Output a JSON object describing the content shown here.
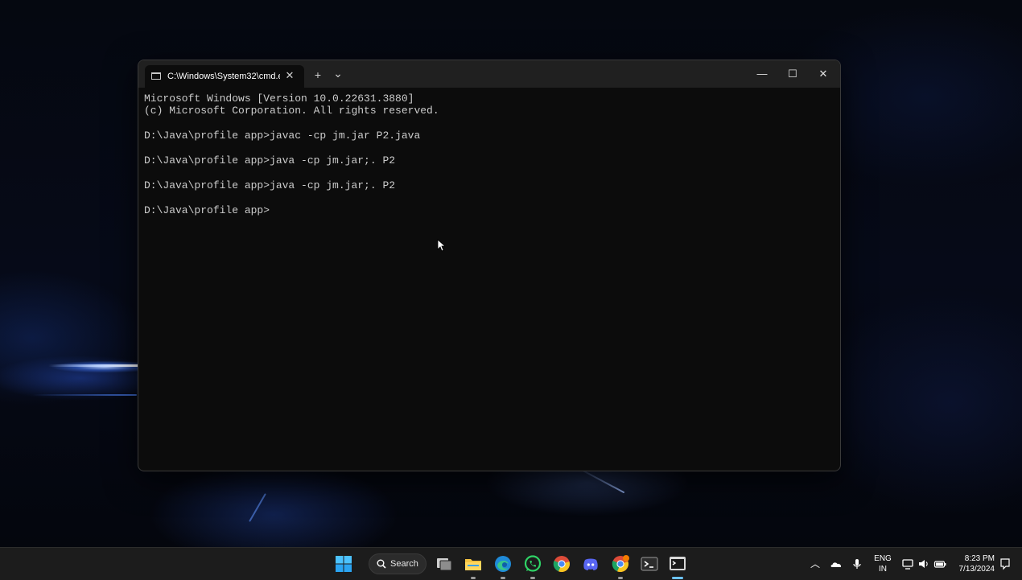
{
  "window": {
    "tab_title": "C:\\Windows\\System32\\cmd.e",
    "new_tab_symbol": "+",
    "dropdown_symbol": "⌄",
    "tab_close_symbol": "✕",
    "minimize_symbol": "—",
    "maximize_symbol": "☐",
    "close_symbol": "✕"
  },
  "console": {
    "lines": [
      "Microsoft Windows [Version 10.0.22631.3880]",
      "(c) Microsoft Corporation. All rights reserved.",
      "",
      "D:\\Java\\profile app>javac -cp jm.jar P2.java",
      "",
      "D:\\Java\\profile app>java -cp jm.jar;. P2",
      "",
      "D:\\Java\\profile app>java -cp jm.jar;. P2",
      "",
      "D:\\Java\\profile app>"
    ]
  },
  "taskbar": {
    "search_label": "Search",
    "apps": [
      "start-icon",
      "search-icon",
      "task-view-icon",
      "file-explorer-icon",
      "edge-icon",
      "whatsapp-icon",
      "chrome-icon",
      "discord-icon",
      "chrome-profile-icon",
      "terminal-icon",
      "active-window-icon"
    ],
    "tray": {
      "lang_top": "ENG",
      "lang_bottom": "IN",
      "time": "8:23 PM",
      "date": "7/13/2024"
    }
  },
  "colors": {
    "console_bg": "#0c0c0c",
    "console_text": "#cccccc",
    "titlebar_bg": "#202020",
    "taskbar_bg": "#1c1c1c",
    "accent": "#0078d4"
  }
}
